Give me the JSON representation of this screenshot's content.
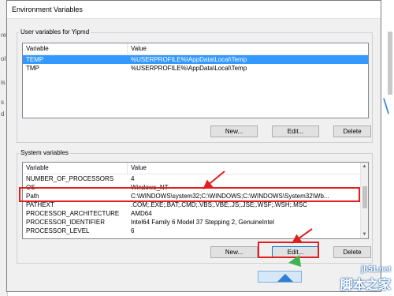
{
  "left_strip_chars": [
    "re",
    "ol",
    "is",
    "s",
    "d"
  ],
  "dialog": {
    "title": "Environment Variables"
  },
  "user_vars": {
    "group_label": "User variables for Yipmd",
    "columns": [
      "Variable",
      "Value"
    ],
    "rows": [
      {
        "variable": "TEMP",
        "value": "%USERPROFILE%\\AppData\\Local\\Temp"
      },
      {
        "variable": "TMP",
        "value": "%USERPROFILE%\\AppData\\Local\\Temp"
      }
    ],
    "selected_row": 0,
    "buttons": {
      "new": "New...",
      "edit": "Edit...",
      "delete": "Delete"
    }
  },
  "system_vars": {
    "group_label": "System variables",
    "columns": [
      "Variable",
      "Value"
    ],
    "rows": [
      {
        "variable": "NUMBER_OF_PROCESSORS",
        "value": "4"
      },
      {
        "variable": "OS",
        "value": "Windows_NT"
      },
      {
        "variable": "Path",
        "value": "C:\\WINDOWS\\system32;C:\\WINDOWS;C:\\WINDOWS\\System32\\Wb..."
      },
      {
        "variable": "PATHEXT",
        "value": ".COM;.EXE;.BAT;.CMD;.VBS;.VBE;.JS;.JSE;.WSF;.WSH;.MSC"
      },
      {
        "variable": "PROCESSOR_ARCHITECTURE",
        "value": "AMD64"
      },
      {
        "variable": "PROCESSOR_IDENTIFIER",
        "value": "Intel64 Family 6 Model 37 Stepping 2, GenuineIntel"
      },
      {
        "variable": "PROCESSOR_LEVEL",
        "value": "6"
      }
    ],
    "buttons": {
      "new": "New...",
      "edit": "Edit...",
      "delete": "Delete"
    }
  },
  "watermark": {
    "site": "jb51.net",
    "brand": "脚本之家"
  },
  "colors": {
    "selection": "#3399ff",
    "annotation": "#e0201f"
  }
}
